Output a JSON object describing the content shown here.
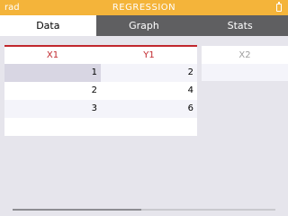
{
  "statusbar": {
    "angle_mode": "rad",
    "title": "REGRESSION",
    "icon": "battery-icon"
  },
  "tabs": [
    {
      "label": "Data",
      "active": true
    },
    {
      "label": "Graph",
      "active": false
    },
    {
      "label": "Stats",
      "active": false
    }
  ],
  "table": {
    "columns": [
      "X1",
      "Y1"
    ],
    "rows": [
      {
        "x": "1",
        "y": "2"
      },
      {
        "x": "2",
        "y": "4"
      },
      {
        "x": "3",
        "y": "6"
      }
    ]
  },
  "table2": {
    "column": "X2"
  },
  "colors": {
    "status_bar": "#f4b43a",
    "tab_bar": "#5f5f61",
    "column_header": "#c1272d",
    "background": "#e6e5ec"
  },
  "scroll": {
    "position_fraction": 0.49
  }
}
